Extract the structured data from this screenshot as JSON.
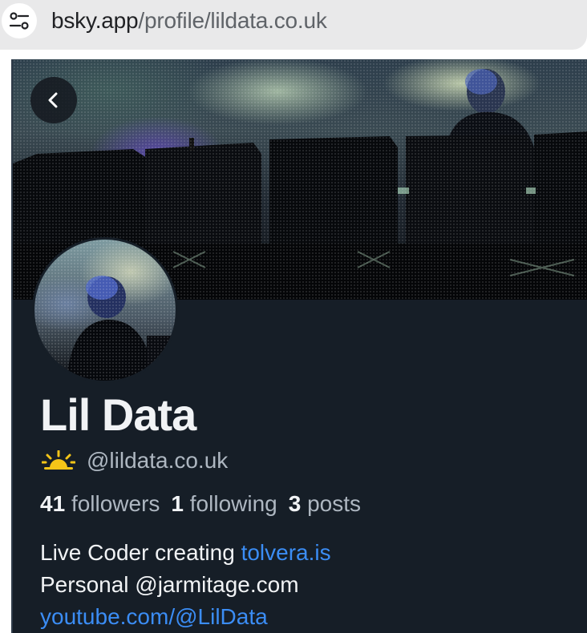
{
  "browser": {
    "url_host": "bsky.app",
    "url_path": "/profile/lildata.co.uk",
    "site_settings_icon": "tune-icon"
  },
  "profile": {
    "display_name": "Lil Data",
    "handle": "@lildata.co.uk",
    "handle_icon": "sun-icon",
    "stats": {
      "followers_count": "41",
      "followers_label": "followers",
      "following_count": "1",
      "following_label": "following",
      "posts_count": "3",
      "posts_label": "posts"
    },
    "bio": {
      "line1_text": "Live Coder creating ",
      "line1_link": "tolvera.is",
      "line2_text": "Personal @jarmitage.com",
      "line3_link": "youtube.com/@LilData"
    }
  },
  "colors": {
    "background": "#161e27",
    "text": "#f1f3f5",
    "muted": "#aeb7c1",
    "link": "#3b8df5",
    "sun": "#f5c518"
  }
}
